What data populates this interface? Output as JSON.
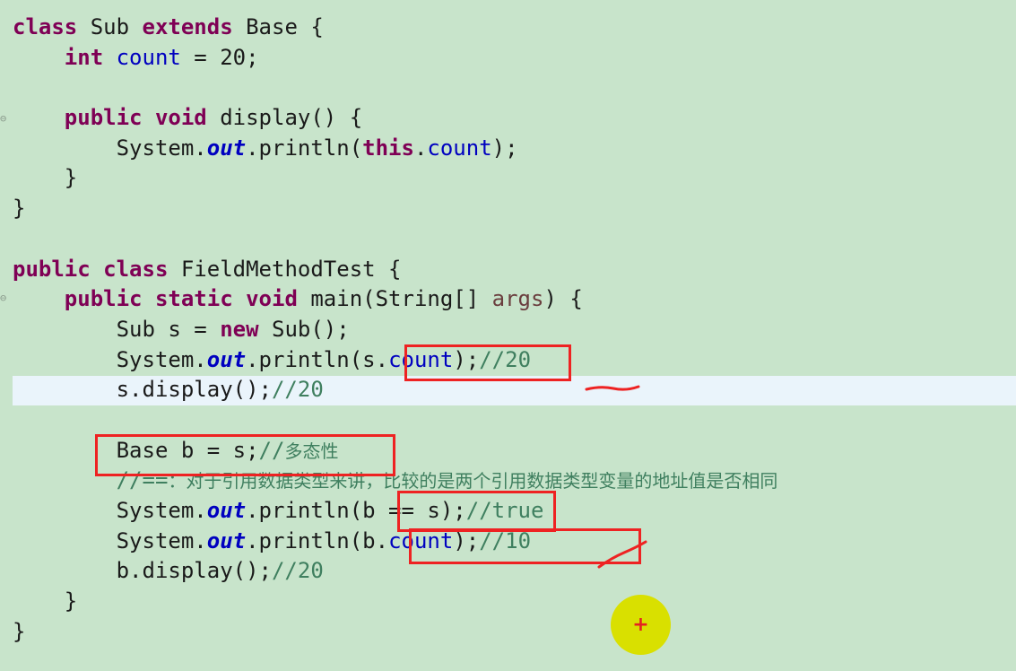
{
  "editor": {
    "lines": [
      [
        {
          "t": "class",
          "c": "kw"
        },
        {
          "t": " Sub ",
          "c": "plain"
        },
        {
          "t": "extends",
          "c": "kw"
        },
        {
          "t": " Base {",
          "c": "plain"
        }
      ],
      [
        {
          "t": "    ",
          "c": "plain"
        },
        {
          "t": "int",
          "c": "kw"
        },
        {
          "t": " ",
          "c": "plain"
        },
        {
          "t": "count",
          "c": "field"
        },
        {
          "t": " = 20;",
          "c": "plain"
        }
      ],
      [],
      [
        {
          "t": "    ",
          "c": "plain"
        },
        {
          "t": "public",
          "c": "kw"
        },
        {
          "t": " ",
          "c": "plain"
        },
        {
          "t": "void",
          "c": "kw"
        },
        {
          "t": " display() {",
          "c": "plain"
        }
      ],
      [
        {
          "t": "        System.",
          "c": "plain"
        },
        {
          "t": "out",
          "c": "static-field"
        },
        {
          "t": ".println(",
          "c": "plain"
        },
        {
          "t": "this",
          "c": "kw"
        },
        {
          "t": ".",
          "c": "plain"
        },
        {
          "t": "count",
          "c": "field"
        },
        {
          "t": ");",
          "c": "plain"
        }
      ],
      [
        {
          "t": "    }",
          "c": "plain"
        }
      ],
      [
        {
          "t": "}",
          "c": "plain"
        }
      ],
      [],
      [
        {
          "t": "public",
          "c": "kw"
        },
        {
          "t": " ",
          "c": "plain"
        },
        {
          "t": "class",
          "c": "kw"
        },
        {
          "t": " FieldMethodTest {",
          "c": "plain"
        }
      ],
      [
        {
          "t": "    ",
          "c": "plain"
        },
        {
          "t": "public",
          "c": "kw"
        },
        {
          "t": " ",
          "c": "plain"
        },
        {
          "t": "static",
          "c": "kw"
        },
        {
          "t": " ",
          "c": "plain"
        },
        {
          "t": "void",
          "c": "kw"
        },
        {
          "t": " main(String[] ",
          "c": "plain"
        },
        {
          "t": "args",
          "c": "param"
        },
        {
          "t": ") {",
          "c": "plain"
        }
      ],
      [
        {
          "t": "        Sub s = ",
          "c": "plain"
        },
        {
          "t": "new",
          "c": "kw"
        },
        {
          "t": " Sub();",
          "c": "plain"
        }
      ],
      [
        {
          "t": "        System.",
          "c": "plain"
        },
        {
          "t": "out",
          "c": "static-field"
        },
        {
          "t": ".println(s.",
          "c": "plain"
        },
        {
          "t": "count",
          "c": "field"
        },
        {
          "t": ");",
          "c": "plain"
        },
        {
          "t": "//20",
          "c": "cmt"
        }
      ],
      [
        {
          "t": "        s.display();",
          "c": "plain"
        },
        {
          "t": "//20",
          "c": "cmt"
        }
      ],
      [],
      [
        {
          "t": "        Base b = s;",
          "c": "plain"
        },
        {
          "t": "//",
          "c": "cmt"
        },
        {
          "t": "多态性",
          "c": "cmt-cn"
        }
      ],
      [
        {
          "t": "        //==",
          "c": "cmt"
        },
        {
          "t": "：对于引用数据类型来讲，比较的是两个引用数据类型变量的地址值是否相同",
          "c": "cmt-cn"
        }
      ],
      [
        {
          "t": "        System.",
          "c": "plain"
        },
        {
          "t": "out",
          "c": "static-field"
        },
        {
          "t": ".println(b == s);",
          "c": "plain"
        },
        {
          "t": "//true",
          "c": "cmt"
        }
      ],
      [
        {
          "t": "        System.",
          "c": "plain"
        },
        {
          "t": "out",
          "c": "static-field"
        },
        {
          "t": ".println(b.",
          "c": "plain"
        },
        {
          "t": "count",
          "c": "field"
        },
        {
          "t": ");",
          "c": "plain"
        },
        {
          "t": "//10",
          "c": "cmt"
        }
      ],
      [
        {
          "t": "        b.display();",
          "c": "plain"
        },
        {
          "t": "//20",
          "c": "cmt"
        }
      ],
      [
        {
          "t": "    }",
          "c": "plain"
        }
      ],
      [
        {
          "t": "}",
          "c": "plain"
        }
      ]
    ]
  },
  "cursor": {
    "symbol": "+"
  },
  "colors": {
    "background": "#c8e4cb",
    "current_line": "#eaf4fb",
    "keyword": "#7f0055",
    "field": "#0000c0",
    "comment": "#3f7f5f",
    "annotation_red": "#ee2222",
    "cursor_yellow": "#d9e000"
  }
}
